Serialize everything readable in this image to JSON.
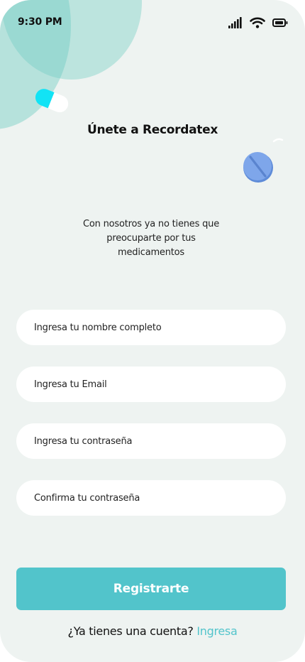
{
  "status_bar": {
    "time": "9:30 PM",
    "icons": [
      "cellular-signal-icon",
      "wifi-icon",
      "battery-icon"
    ]
  },
  "header": {
    "title": "Únete a Recordatex"
  },
  "intro": {
    "text": "Con nosotros ya no tienes que preocuparte por tus medicamentos"
  },
  "form": {
    "full_name": {
      "placeholder": "Ingresa tu nombre completo",
      "value": ""
    },
    "email": {
      "placeholder": "Ingresa tu Email",
      "value": ""
    },
    "password": {
      "placeholder": "Ingresa tu contraseña",
      "value": ""
    },
    "confirm_password": {
      "placeholder": "Confirma tu contraseña",
      "value": ""
    }
  },
  "actions": {
    "register_label": "Registrarte",
    "login_prompt": "¿Ya tienes una cuenta?",
    "login_link": "Ingresa"
  },
  "decorations": [
    "capsule-pill-icon",
    "round-tablet-icon"
  ],
  "colors": {
    "accent": "#52c4cb",
    "background": "#eef3f1",
    "blob": "#70cec4",
    "capsule_cyan": "#12e3f5",
    "tablet_blue": "#7ea6ea"
  }
}
